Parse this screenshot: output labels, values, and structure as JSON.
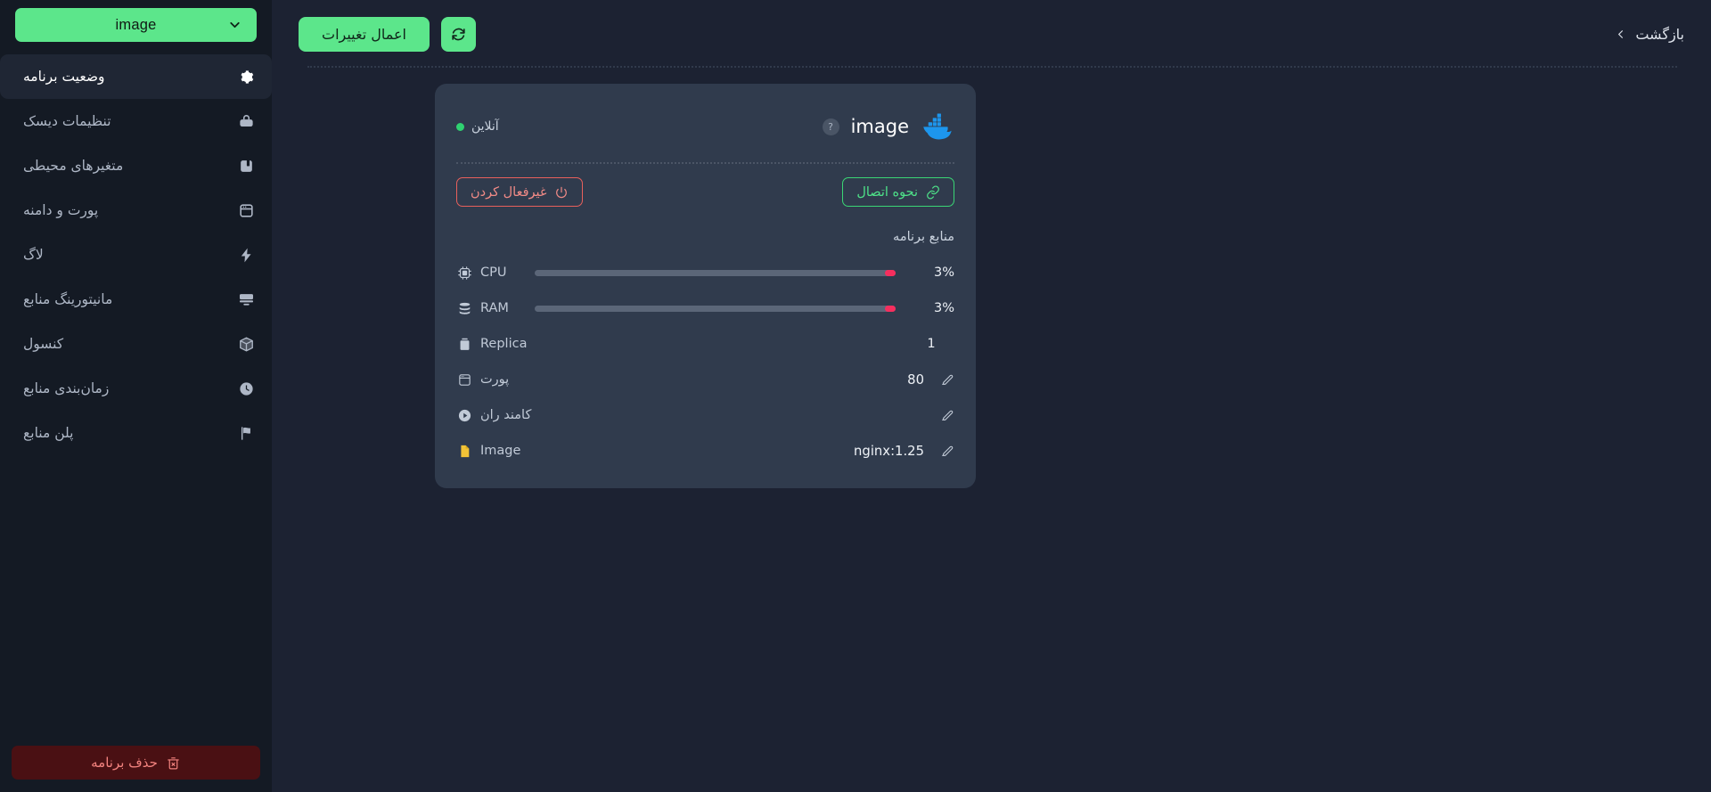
{
  "topbar": {
    "apply_label": "اعمال تغییرات",
    "refresh_icon": "refresh-icon",
    "back_label": "بازگشت"
  },
  "sidebar": {
    "app_select": {
      "label": "image",
      "chevron_icon": "chevron-down-icon"
    },
    "items": [
      {
        "label": "وضعیت برنامه",
        "icon": "gear-icon",
        "active": true
      },
      {
        "label": "تنظیمات دیسک",
        "icon": "disk-icon",
        "active": false
      },
      {
        "label": "متغیرهای محیطی",
        "icon": "variable-icon",
        "active": false
      },
      {
        "label": "پورت و دامنه",
        "icon": "window-icon",
        "active": false
      },
      {
        "label": "لاگ",
        "icon": "bolt-icon",
        "active": false
      },
      {
        "label": "مانیتورینگ منابع",
        "icon": "monitor-icon",
        "active": false
      },
      {
        "label": "کنسول",
        "icon": "cube-icon",
        "active": false
      },
      {
        "label": "زمان‌بندی منابع",
        "icon": "clock-icon",
        "active": false
      },
      {
        "label": "پلن منابع",
        "icon": "flag-icon",
        "active": false
      }
    ],
    "delete_button": {
      "label": "حذف برنامه",
      "icon": "trash-x-icon"
    }
  },
  "card": {
    "title": "image",
    "logo_icon": "docker-icon",
    "help_icon": "question-mark-icon",
    "status": {
      "label": "آنلاین",
      "dot_color": "#2fd271"
    },
    "actions": {
      "connect": {
        "label": "نحوه اتصال",
        "icon": "link-icon"
      },
      "disable": {
        "label": "غیرفعال کردن",
        "icon": "power-icon"
      }
    },
    "resources_title": "منابع برنامه",
    "resources": [
      {
        "name": "CPU",
        "icon": "cpu-icon",
        "kind": "bar",
        "value": "3%",
        "percent": 3
      },
      {
        "name": "RAM",
        "icon": "ram-icon",
        "kind": "bar",
        "value": "3%",
        "percent": 3
      },
      {
        "name": "Replica",
        "icon": "replica-icon",
        "kind": "text",
        "value": "1",
        "editable": false
      },
      {
        "name": "پورت",
        "icon": "port-icon",
        "kind": "text",
        "value": "80",
        "editable": true
      },
      {
        "name": "کامند ران",
        "icon": "play-icon",
        "kind": "text",
        "value": "",
        "editable": true
      },
      {
        "name": "Image",
        "icon": "file-icon",
        "kind": "text",
        "value": "nginx:1.25",
        "editable": true
      }
    ]
  },
  "colors": {
    "accent_green": "#5ce68b",
    "bar_fill": "#f62e5e",
    "danger": "#e8605c",
    "bg": "#1c2232",
    "sidebar_bg": "#141a24",
    "card_bg": "#303b4d"
  }
}
